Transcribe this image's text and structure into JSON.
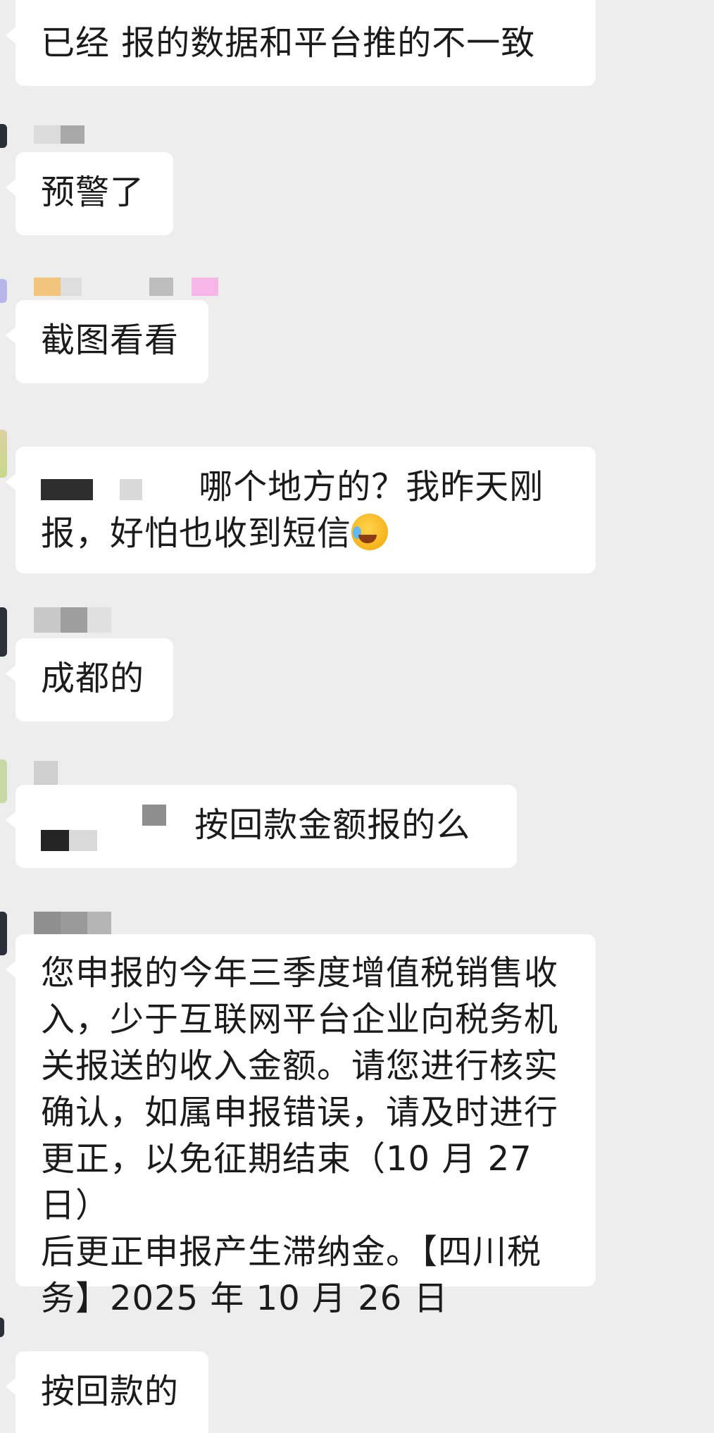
{
  "messages": [
    {
      "text": "已经 报的数据和平台推的不一致"
    },
    {
      "text": "预警了"
    },
    {
      "text": "截图看看"
    },
    {
      "text_line1": "哪个地方的？我昨天刚",
      "text_line2": "报，好怕也收到短信",
      "emoji": "laughing-crying-emoji"
    },
    {
      "text": "成都的"
    },
    {
      "text": "按回款金额报的么"
    },
    {
      "lines": [
        "您申报的今年三季度增值税销售收",
        "入，少于互联网平台企业向税务机",
        "关报送的收入金额。请您进行核实",
        "确认，如属申报错误，请及时进行",
        "更正，以免征期结束（10 月 27 日）",
        "后更正申报产生滞纳金。【四川税",
        "务】2025 年 10 月 26 日"
      ]
    },
    {
      "text": "按回款的"
    }
  ],
  "colors": {
    "background": "#ededed",
    "bubble": "#ffffff",
    "text": "#1b1b1b"
  }
}
